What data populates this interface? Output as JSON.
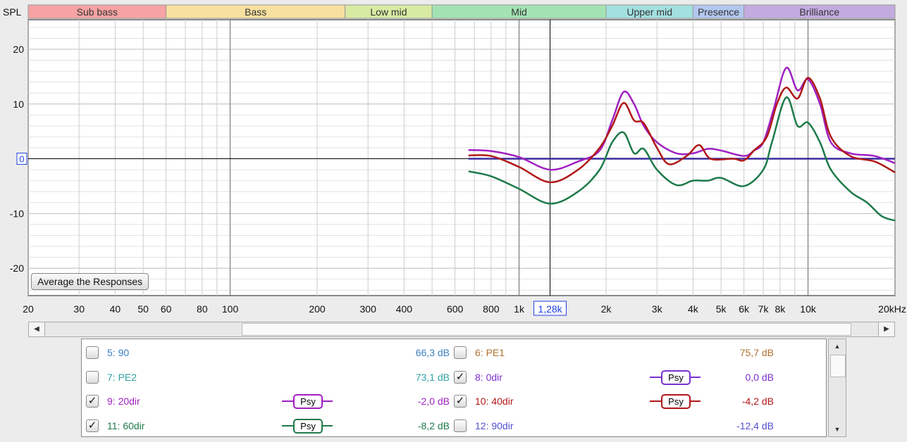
{
  "y_axis_label": "SPL",
  "bands": [
    {
      "label": "Sub bass",
      "from": 20,
      "to": 60,
      "color": "#f7a3a3"
    },
    {
      "label": "Bass",
      "from": 60,
      "to": 250,
      "color": "#f8e0a0"
    },
    {
      "label": "Low mid",
      "from": 250,
      "to": 500,
      "color": "#d8eba3"
    },
    {
      "label": "Mid",
      "from": 500,
      "to": 2000,
      "color": "#a3e3b3"
    },
    {
      "label": "Upper mid",
      "from": 2000,
      "to": 4000,
      "color": "#a3e0e0"
    },
    {
      "label": "Presence",
      "from": 4000,
      "to": 6000,
      "color": "#b3c8f0"
    },
    {
      "label": "Brilliance",
      "from": 6000,
      "to": 20000,
      "color": "#c3abe0"
    }
  ],
  "chart_data": {
    "type": "line",
    "xscale": "log",
    "xlim": [
      20,
      20000
    ],
    "ylim": [
      -25,
      25.4
    ],
    "y_ticks": [
      {
        "v": 20,
        "label": "20"
      },
      {
        "v": 10,
        "label": "10"
      },
      {
        "v": -10,
        "label": "-10"
      },
      {
        "v": -20,
        "label": "-20"
      }
    ],
    "y_ref_label": "0",
    "x_ticks": [
      {
        "v": 20,
        "label": "20"
      },
      {
        "v": 30,
        "label": "30"
      },
      {
        "v": 40,
        "label": "40"
      },
      {
        "v": 50,
        "label": "50"
      },
      {
        "v": 60,
        "label": "60"
      },
      {
        "v": 80,
        "label": "80"
      },
      {
        "v": 100,
        "label": "100"
      },
      {
        "v": 200,
        "label": "200"
      },
      {
        "v": 300,
        "label": "300"
      },
      {
        "v": 400,
        "label": "400"
      },
      {
        "v": 600,
        "label": "600"
      },
      {
        "v": 800,
        "label": "800"
      },
      {
        "v": 1000,
        "label": "1k"
      },
      {
        "v": 2000,
        "label": "2k"
      },
      {
        "v": 3000,
        "label": "3k"
      },
      {
        "v": 4000,
        "label": "4k"
      },
      {
        "v": 5000,
        "label": "5k"
      },
      {
        "v": 6000,
        "label": "6k"
      },
      {
        "v": 7000,
        "label": "7k"
      },
      {
        "v": 8000,
        "label": "8k"
      },
      {
        "v": 10000,
        "label": "10k"
      },
      {
        "v": 20000,
        "label": "20kHz"
      }
    ],
    "cursor": {
      "v": 1280,
      "label": "1,28k"
    },
    "series": [
      {
        "name": "8: 0dir",
        "color": "#3a2c9e",
        "points": [
          [
            668,
            0
          ],
          [
            20000,
            0
          ]
        ]
      },
      {
        "name": "11: 60dir",
        "color": "#1e7a4a",
        "points": [
          [
            668,
            -2.3
          ],
          [
            800,
            -3.2
          ],
          [
            1000,
            -5.5
          ],
          [
            1280,
            -8.2
          ],
          [
            1600,
            -6
          ],
          [
            1900,
            -2
          ],
          [
            2100,
            3
          ],
          [
            2300,
            4.8
          ],
          [
            2500,
            1
          ],
          [
            2700,
            1.8
          ],
          [
            3000,
            -2
          ],
          [
            3500,
            -4.8
          ],
          [
            4000,
            -4
          ],
          [
            4500,
            -4
          ],
          [
            5000,
            -3.5
          ],
          [
            6000,
            -5
          ],
          [
            7000,
            -2
          ],
          [
            7500,
            3
          ],
          [
            8400,
            11.2
          ],
          [
            9200,
            6
          ],
          [
            10000,
            6.6
          ],
          [
            11000,
            3
          ],
          [
            12000,
            -2
          ],
          [
            14000,
            -6
          ],
          [
            16000,
            -8
          ],
          [
            18000,
            -10.5
          ],
          [
            20000,
            -11.3
          ]
        ]
      },
      {
        "name": "9: 20dir",
        "color": "#a020c0",
        "points": [
          [
            668,
            1.6
          ],
          [
            800,
            1.4
          ],
          [
            1000,
            0.3
          ],
          [
            1280,
            -2
          ],
          [
            1600,
            -0.5
          ],
          [
            1900,
            1.5
          ],
          [
            2100,
            7
          ],
          [
            2300,
            12.2
          ],
          [
            2500,
            10
          ],
          [
            2700,
            6
          ],
          [
            3000,
            3
          ],
          [
            3500,
            1
          ],
          [
            4000,
            1
          ],
          [
            4500,
            1.8
          ],
          [
            5000,
            1.5
          ],
          [
            6000,
            0.5
          ],
          [
            6500,
            1.5
          ],
          [
            7000,
            3
          ],
          [
            7600,
            9
          ],
          [
            8400,
            16.6
          ],
          [
            9200,
            12.5
          ],
          [
            10000,
            14.5
          ],
          [
            11000,
            10
          ],
          [
            12000,
            3
          ],
          [
            14000,
            1
          ],
          [
            17000,
            0.5
          ],
          [
            20000,
            -0.8
          ]
        ]
      },
      {
        "name": "10: 40dir",
        "color": "#b01818",
        "points": [
          [
            668,
            0.6
          ],
          [
            800,
            0.5
          ],
          [
            1000,
            -1.5
          ],
          [
            1280,
            -4.3
          ],
          [
            1600,
            -2
          ],
          [
            1900,
            2
          ],
          [
            2100,
            6
          ],
          [
            2300,
            10.2
          ],
          [
            2500,
            7
          ],
          [
            2700,
            6.5
          ],
          [
            3000,
            2
          ],
          [
            3300,
            -1
          ],
          [
            3800,
            0.5
          ],
          [
            4200,
            2.5
          ],
          [
            4600,
            0
          ],
          [
            5500,
            0
          ],
          [
            6000,
            -0.3
          ],
          [
            6500,
            1.5
          ],
          [
            7200,
            4
          ],
          [
            7800,
            10
          ],
          [
            8400,
            13
          ],
          [
            9200,
            11
          ],
          [
            10000,
            14.8
          ],
          [
            11000,
            11
          ],
          [
            12000,
            4
          ],
          [
            14000,
            0.5
          ],
          [
            17000,
            -0.5
          ],
          [
            20000,
            -2.5
          ]
        ]
      }
    ]
  },
  "average_button": "Average the Responses",
  "legend": [
    {
      "label": "5: 90",
      "value": "66,3 dB",
      "color": "#3a7fc0",
      "checked": false,
      "psy": null
    },
    {
      "label": "6: PE1",
      "value": "75,7 dB",
      "color": "#b07030",
      "checked": false,
      "psy": null
    },
    {
      "label": "7: PE2",
      "value": "73,1 dB",
      "color": "#30a0a0",
      "checked": false,
      "psy": null
    },
    {
      "label": "8: 0dir",
      "value": "0,0 dB",
      "color": "#7a30d0",
      "checked": true,
      "psy": "Psy"
    },
    {
      "label": "9: 20dir",
      "value": "-2,0 dB",
      "color": "#a020c0",
      "checked": true,
      "psy": "Psy"
    },
    {
      "label": "10: 40dir",
      "value": "-4,2 dB",
      "color": "#b01818",
      "checked": true,
      "psy": "Psy"
    },
    {
      "label": "11: 60dir",
      "value": "-8,2 dB",
      "color": "#1e7a4a",
      "checked": true,
      "psy": "Psy"
    },
    {
      "label": "12: 90dir",
      "value": "-12,4 dB",
      "color": "#5050d0",
      "checked": false,
      "psy": null
    }
  ],
  "check_glyph": "✓",
  "scroll": {
    "left": "◀",
    "right": "▶",
    "up": "▲",
    "down": "▼"
  }
}
